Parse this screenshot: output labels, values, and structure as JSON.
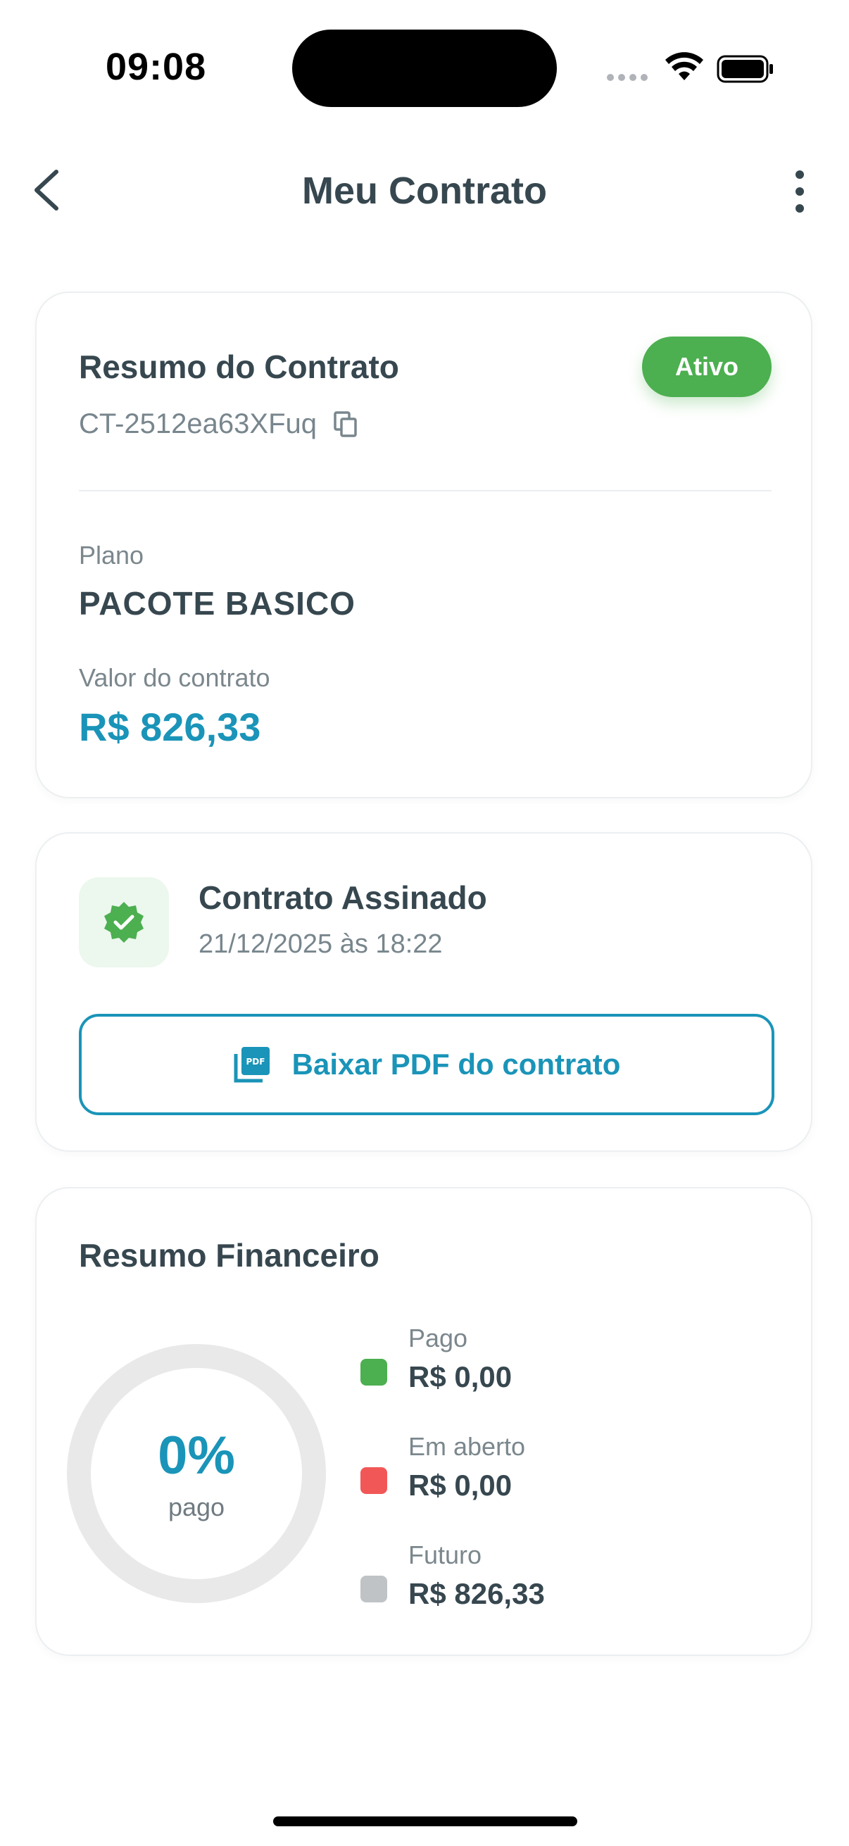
{
  "status_bar": {
    "time": "09:08"
  },
  "header": {
    "title": "Meu Contrato",
    "back_icon": "chevron-left-icon",
    "more_icon": "more-vertical-icon"
  },
  "summary": {
    "title": "Resumo do Contrato",
    "status": "Ativo",
    "status_color": "#4caf50",
    "contract_id": "CT-2512ea63XFuq",
    "plan_label": "Plano",
    "plan_value": "PACOTE BASICO",
    "value_label": "Valor do contrato",
    "contract_value": "R$ 826,33"
  },
  "signed": {
    "icon": "verified-badge-icon",
    "title": "Contrato Assinado",
    "date": "21/12/2025 às 18:22",
    "pdf_button_label": "Baixar PDF do contrato",
    "pdf_icon": "pdf-file-icon"
  },
  "finance": {
    "title": "Resumo Financeiro",
    "percent_paid": "0%",
    "percent_caption": "pago",
    "paid_fraction": 0,
    "legend": [
      {
        "label": "Pago",
        "value": "R$ 0,00",
        "color": "#4caf50"
      },
      {
        "label": "Em aberto",
        "value": "R$ 0,00",
        "color": "#f25757"
      },
      {
        "label": "Futuro",
        "value": "R$ 826,33",
        "color": "#bfc3c6"
      }
    ]
  },
  "colors": {
    "accent": "#1a94b8",
    "text_primary": "#37474f",
    "text_secondary": "#78868d"
  }
}
